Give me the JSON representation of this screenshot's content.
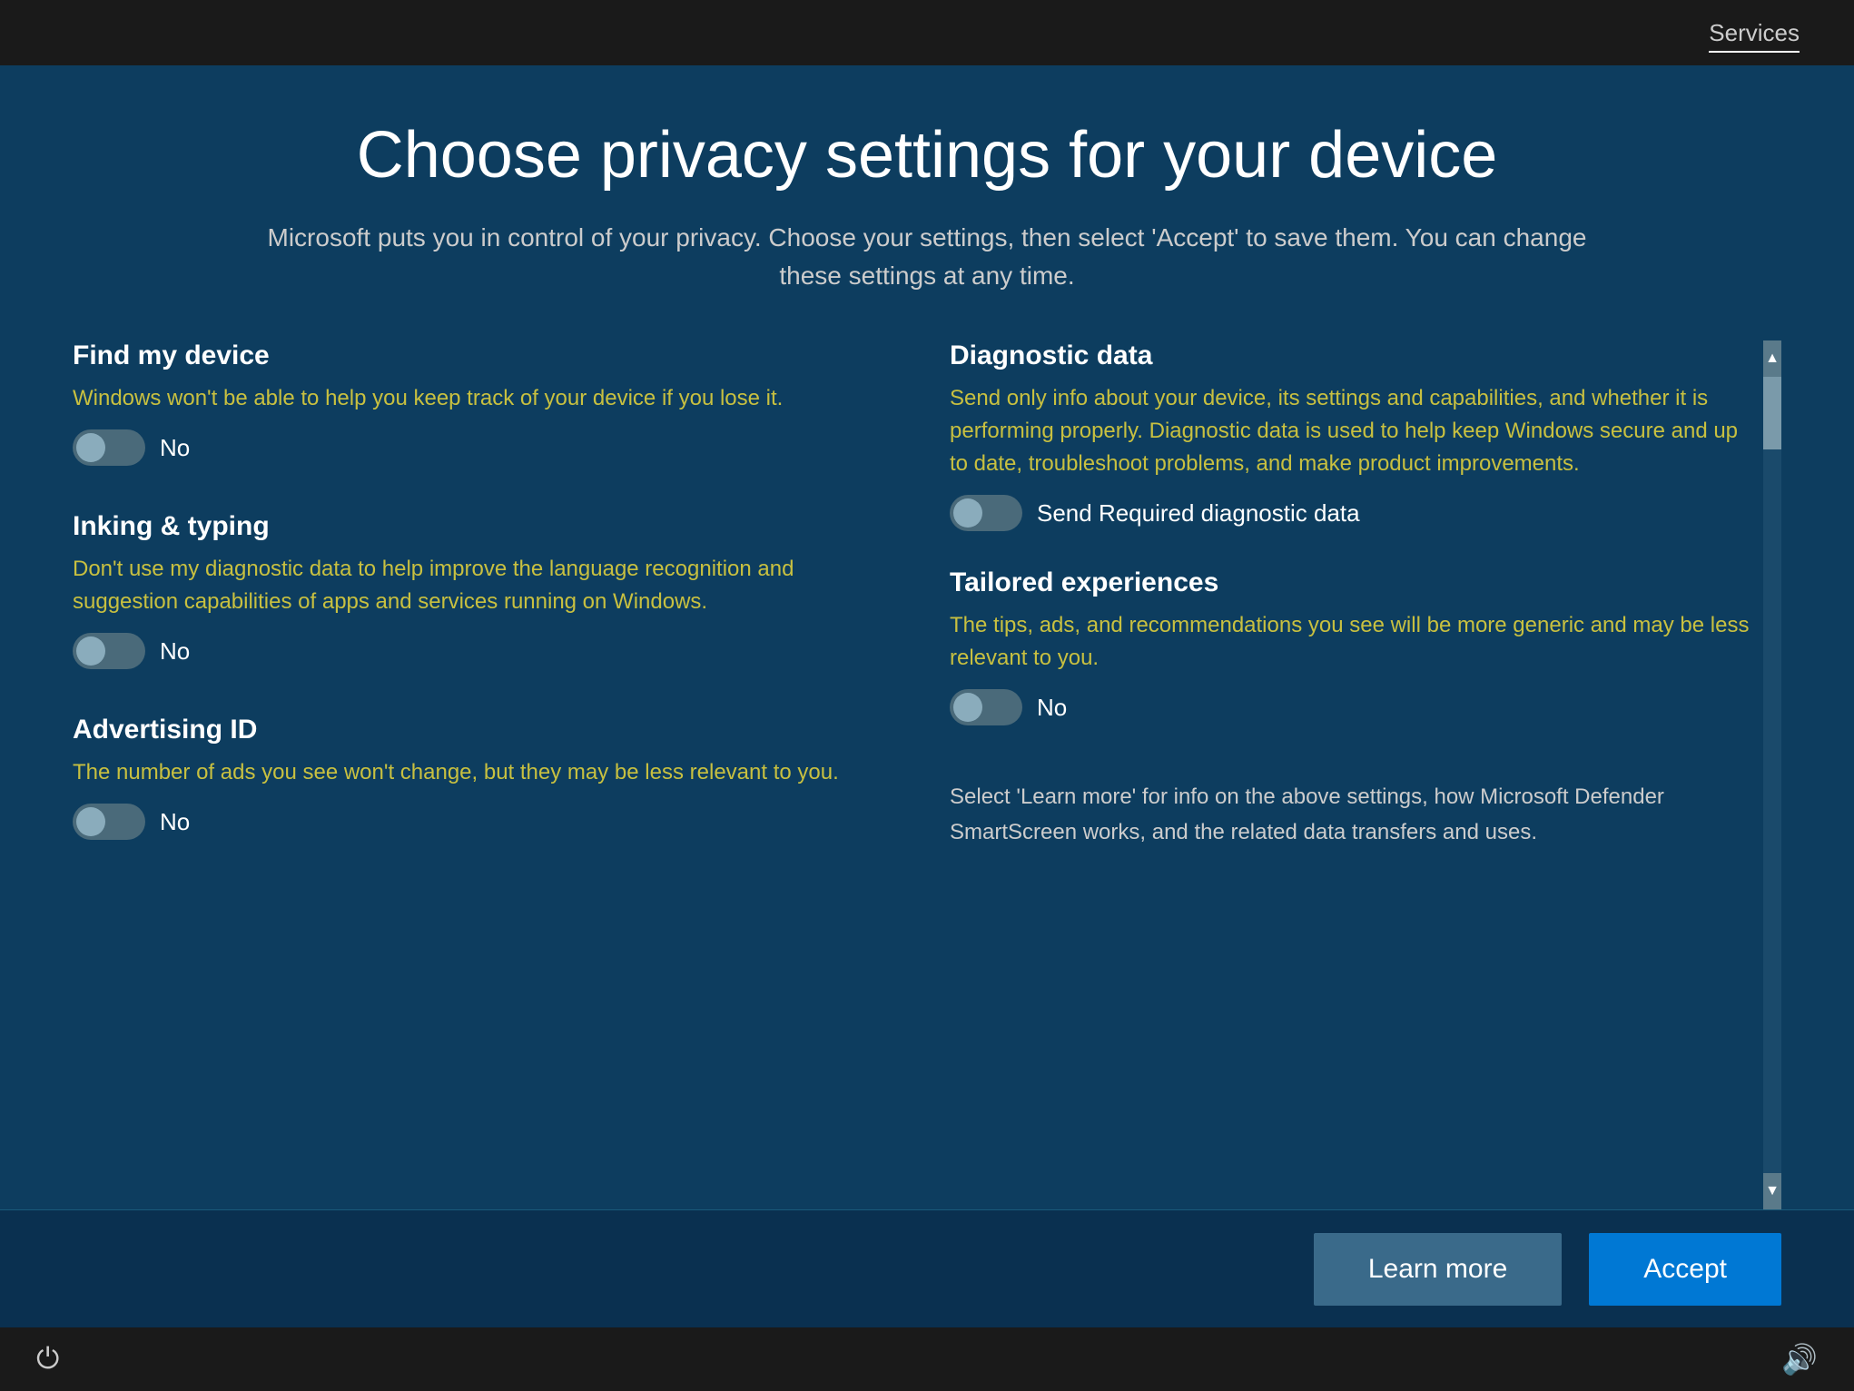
{
  "topbar": {
    "services_label": "Services"
  },
  "header": {
    "title": "Choose privacy settings for your device",
    "subtitle": "Microsoft puts you in control of your privacy. Choose your settings, then select 'Accept' to save them. You can change these settings at any time."
  },
  "settings": {
    "left_column": [
      {
        "id": "find-my-device",
        "title": "Find my device",
        "description": "Windows won't be able to help you keep track of your device if you lose it.",
        "toggle_state": "off",
        "toggle_label": "No"
      },
      {
        "id": "inking-typing",
        "title": "Inking & typing",
        "description": "Don't use my diagnostic data to help improve the language recognition and suggestion capabilities of apps and services running on Windows.",
        "toggle_state": "off",
        "toggle_label": "No"
      },
      {
        "id": "advertising-id",
        "title": "Advertising ID",
        "description": "The number of ads you see won't change, but they may be less relevant to you.",
        "toggle_state": "off",
        "toggle_label": "No"
      }
    ],
    "right_column": [
      {
        "id": "diagnostic-data",
        "title": "Diagnostic data",
        "description": "Send only info about your device, its settings and capabilities, and whether it is performing properly. Diagnostic data is used to help keep Windows secure and up to date, troubleshoot problems, and make product improvements.",
        "toggle_state": "off",
        "toggle_label": "Send Required diagnostic data"
      },
      {
        "id": "tailored-experiences",
        "title": "Tailored experiences",
        "description": "The tips, ads, and recommendations you see will be more generic and may be less relevant to you.",
        "toggle_state": "off",
        "toggle_label": "No"
      }
    ],
    "info_text": "Select 'Learn more' for info on the above settings, how Microsoft Defender SmartScreen works, and the related data transfers and uses."
  },
  "buttons": {
    "learn_more": "Learn more",
    "accept": "Accept"
  },
  "taskbar": {
    "power_icon": "⏻",
    "volume_icon": "🔊"
  }
}
